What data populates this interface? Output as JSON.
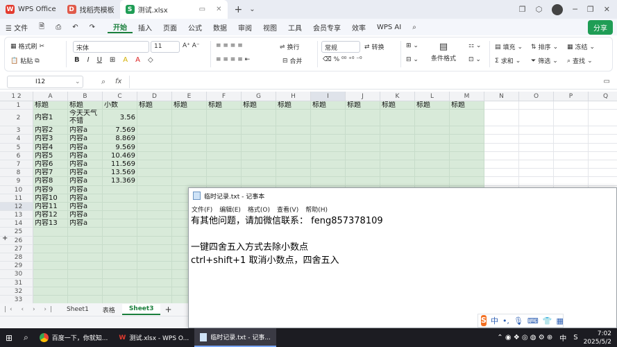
{
  "titlebar": {
    "tabs": [
      {
        "label": "WPS Office",
        "logo": "W",
        "color": "#e33b2e"
      },
      {
        "label": "找稻壳模板",
        "logo": "D",
        "color": "#e05a4a"
      },
      {
        "label": "测试.xlsx",
        "logo": "S",
        "color": "#1f9d55"
      }
    ],
    "new_tab": "+",
    "tab_menu": "⌄",
    "min": "─",
    "max": "❐",
    "close": "✕"
  },
  "menubar": {
    "file": "文件",
    "items": [
      "开始",
      "插入",
      "页面",
      "公式",
      "数据",
      "审阅",
      "视图",
      "工具",
      "会员专享",
      "效率",
      "WPS AI"
    ],
    "active": "开始",
    "share": "分享"
  },
  "ribbon": {
    "format_painter": "格式刷",
    "paste": "粘贴",
    "font": "宋体",
    "font_size": "11",
    "wrap": "换行",
    "merge": "合并",
    "number_format": "常规",
    "convert": "转换",
    "conditional": "条件格式",
    "fill": "填充",
    "sort": "排序",
    "freeze": "冻结",
    "sum": "求和",
    "filter": "筛选",
    "find": "查找"
  },
  "formula_bar": {
    "name_box": "I12",
    "fx": "fx",
    "value": ""
  },
  "grid": {
    "level_buttons": [
      "1",
      "2"
    ],
    "columns": [
      "A",
      "B",
      "C",
      "D",
      "E",
      "F",
      "G",
      "H",
      "I",
      "J",
      "K",
      "L",
      "M",
      "N",
      "O",
      "P",
      "Q"
    ],
    "rows": [
      {
        "n": "1",
        "cells": [
          "标题",
          "标题",
          "小数",
          "标题",
          "标题",
          "标题",
          "标题",
          "标题",
          "标题",
          "标题",
          "标题",
          "标题",
          "标题"
        ]
      },
      {
        "n": "2",
        "cells": [
          "内容1",
          "今天天气不错",
          "3.56"
        ]
      },
      {
        "n": "3",
        "cells": [
          "内容2",
          "内容a",
          "7.569"
        ]
      },
      {
        "n": "4",
        "cells": [
          "内容3",
          "内容a",
          "8.869"
        ]
      },
      {
        "n": "5",
        "cells": [
          "内容4",
          "内容a",
          "9.569"
        ]
      },
      {
        "n": "6",
        "cells": [
          "内容5",
          "内容a",
          "10.469"
        ]
      },
      {
        "n": "7",
        "cells": [
          "内容6",
          "内容a",
          "11.569"
        ]
      },
      {
        "n": "8",
        "cells": [
          "内容7",
          "内容a",
          "13.569"
        ]
      },
      {
        "n": "9",
        "cells": [
          "内容8",
          "内容a",
          "13.369"
        ]
      },
      {
        "n": "10",
        "cells": [
          "内容9",
          "内容a"
        ]
      },
      {
        "n": "11",
        "cells": [
          "内容10",
          "内容a"
        ]
      },
      {
        "n": "12",
        "cells": [
          "内容11",
          "内容a"
        ]
      },
      {
        "n": "13",
        "cells": [
          "内容12",
          "内容a"
        ]
      },
      {
        "n": "14",
        "cells": [
          "内容13",
          "内容a"
        ]
      },
      {
        "n": "25",
        "cells": []
      },
      {
        "n": "26",
        "cells": []
      },
      {
        "n": "27",
        "cells": []
      },
      {
        "n": "28",
        "cells": []
      },
      {
        "n": "29",
        "cells": []
      },
      {
        "n": "30",
        "cells": []
      },
      {
        "n": "31",
        "cells": []
      },
      {
        "n": "32",
        "cells": []
      },
      {
        "n": "33",
        "cells": []
      }
    ]
  },
  "sheets": {
    "items": [
      "Sheet1",
      "表格",
      "Sheet3"
    ],
    "active": "Sheet3",
    "add": "+"
  },
  "notepad": {
    "title": "临时记录.txt - 记事本",
    "menu": [
      "文件(F)",
      "编辑(E)",
      "格式(O)",
      "查看(V)",
      "帮助(H)"
    ],
    "lines": [
      "有其他问题，请加微信联系： feng857378109",
      "",
      "一键四舍五入方式去除小数点",
      "ctrl+shift+1 取消小数点，四舍五入"
    ]
  },
  "ime": {
    "logo": "S",
    "mode": "中"
  },
  "taskbar": {
    "apps": [
      {
        "label": "百度一下，你就知..."
      },
      {
        "label": "测试.xlsx - WPS O..."
      },
      {
        "label": "临时记录.txt - 记事..."
      }
    ],
    "lang": "中",
    "time": "7:02",
    "date": "2025/5/2"
  }
}
